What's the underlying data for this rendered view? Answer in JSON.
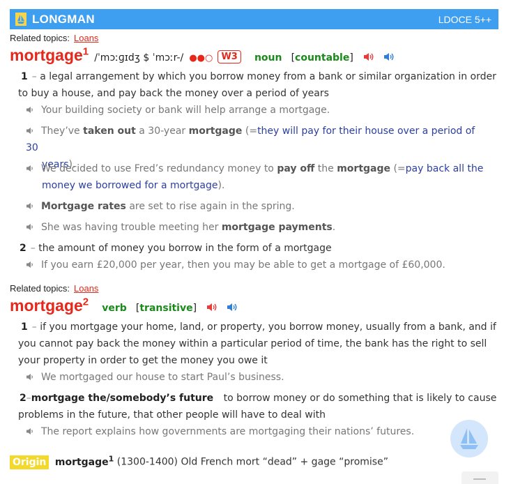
{
  "header": {
    "brand": "LONGMAN",
    "edition": "LDOCE 5++"
  },
  "entries": [
    {
      "related_label": "Related topics:",
      "related_link": "Loans",
      "headword": "mortgage",
      "homnum": "1",
      "pron": "/ˈmɔːɡɪdʒ $ ˈmɔːr-/",
      "freq_dots": "●●○",
      "freq_badge": "W3",
      "pos": "noun",
      "gram": "countable",
      "senses": [
        {
          "num": "1",
          "def": [
            "a legal arrangement by which you borrow money from a bank or similar organization in order",
            "to buy a house, and pay back the money over a period of years"
          ],
          "examples": [
            {
              "text": "Your building society or bank will help arrange a mortgage."
            },
            {
              "pre": "They’ve",
              "b1": "taken out",
              "mid": "a 30-year",
              "b2": "mortgage",
              "post": "(=",
              "gloss": "they will pay for their house over a period of 30",
              "gloss2": "years",
              "end": ")."
            },
            {
              "pre": "We decided to use Fred’s redundancy money to",
              "b1": "pay off",
              "mid": "the",
              "b2": "mortgage",
              "post": "(=",
              "gloss": "pay back all the",
              "gloss2": "money we borrowed for a mortgage",
              "end": ")."
            },
            {
              "b1": "Mortgage rates",
              "post": "are set to rise again in the spring."
            },
            {
              "pre": "She was having trouble meeting her",
              "b1": "mortgage payments",
              "end": "."
            }
          ]
        },
        {
          "num": "2",
          "def": [
            "the amount of money you borrow in the form of a mortgage"
          ],
          "examples": [
            {
              "text": "If you earn £20,000 per year, then you may be able to get a mortgage of £60,000."
            }
          ]
        }
      ]
    },
    {
      "related_label": "Related topics:",
      "related_link": "Loans",
      "headword": "mortgage",
      "homnum": "2",
      "pos": "verb",
      "gram": "transitive",
      "senses": [
        {
          "num": "1",
          "def": [
            "if you mortgage your home, land, or property, you borrow money, usually from a bank, and if",
            "you cannot pay back the money within a particular period of time, the bank has the right to sell",
            "your property in order to get the money you owe it"
          ],
          "examples": [
            {
              "text": "We mortgaged our house to start Paul’s business."
            }
          ]
        },
        {
          "num": "2",
          "phrase": "mortgage the/somebody’s future",
          "def": [
            "to borrow money or do something that is likely to cause",
            "problems in the future, that other people will have to deal with"
          ],
          "examples": [
            {
              "text": "The report explains how governments are mortgaging their nations’ futures."
            }
          ]
        }
      ]
    }
  ],
  "origin": {
    "badge": "Origin",
    "word": "mortgage",
    "homnum": "1",
    "text": "(1300-1400) Old French mort “dead” + gage “promise”"
  },
  "colors": {
    "headword": "#e5281b",
    "pos": "#1a8a1a",
    "header": "#3e9ef0",
    "gloss": "#2c3f9e",
    "origin_badge": "#f3d92c"
  }
}
